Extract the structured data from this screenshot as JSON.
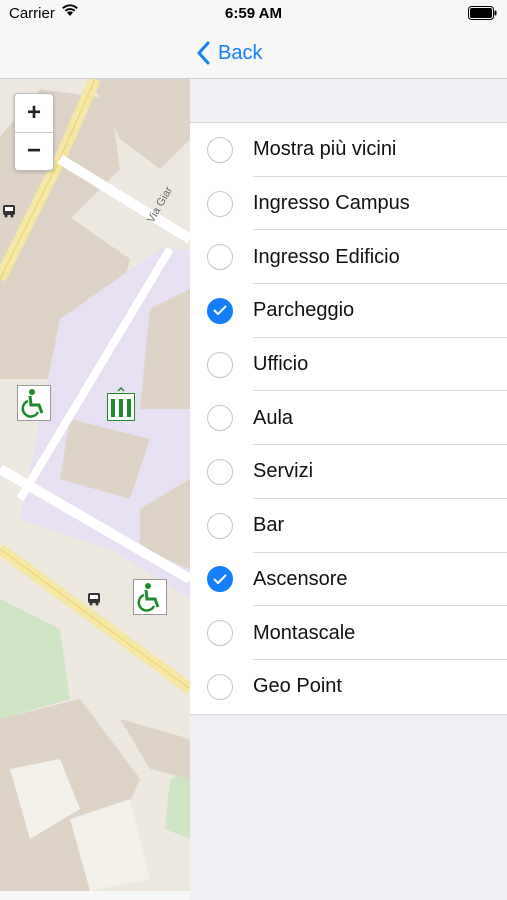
{
  "status_bar": {
    "carrier": "Carrier",
    "time": "6:59 AM"
  },
  "nav": {
    "back_label": "Back",
    "accent_color": "#147efb"
  },
  "map": {
    "zoom_in_label": "+",
    "zoom_out_label": "−",
    "street_label": "Via Giar"
  },
  "filters": [
    {
      "label": "Mostra più vicini",
      "checked": false
    },
    {
      "label": "Ingresso Campus",
      "checked": false
    },
    {
      "label": "Ingresso Edificio",
      "checked": false
    },
    {
      "label": "Parcheggio",
      "checked": true
    },
    {
      "label": "Ufficio",
      "checked": false
    },
    {
      "label": "Aula",
      "checked": false
    },
    {
      "label": "Servizi",
      "checked": false
    },
    {
      "label": "Bar",
      "checked": false
    },
    {
      "label": "Ascensore",
      "checked": true
    },
    {
      "label": "Montascale",
      "checked": false
    },
    {
      "label": "Geo Point",
      "checked": false
    }
  ]
}
